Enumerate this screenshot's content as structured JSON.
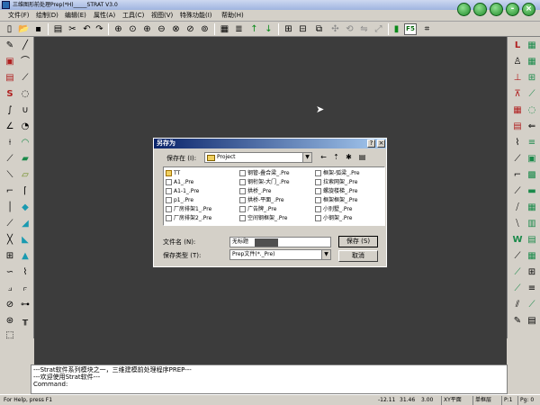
{
  "window": {
    "title": "三维图形前处理Prep(*H)_____STRAT V3.0"
  },
  "menu": [
    "文件(F)",
    "绘制(D)",
    "编辑(E)",
    "属性(A)",
    "工具(C)",
    "视图(V)",
    "特殊功能(I)",
    "帮助(H)"
  ],
  "toolbar": {
    "f5_label": "F5"
  },
  "dialog": {
    "title": "另存为",
    "help_button": "?",
    "close_button": "×",
    "save_in_label": "保存在 (I):",
    "save_in_value": "Project",
    "files": [
      {
        "name": "TT",
        "type": "folder"
      },
      {
        "name": "A1_.Pre",
        "type": "file"
      },
      {
        "name": "A1-1_.Pre",
        "type": "file"
      },
      {
        "name": "p1_.Pre",
        "type": "file"
      },
      {
        "name": "厂房排架1_.Pre",
        "type": "file"
      },
      {
        "name": "厂房排架2_.Pre",
        "type": "file"
      },
      {
        "name": "钢管-叠合梁_.Pre",
        "type": "file"
      },
      {
        "name": "钢桁架-大门_.Pre",
        "type": "file"
      },
      {
        "name": "拱桥_.Pre",
        "type": "file"
      },
      {
        "name": "拱桥-平面_.Pre",
        "type": "file"
      },
      {
        "name": "广告牌_.Pre",
        "type": "file"
      },
      {
        "name": "空间钢框架_.Pre",
        "type": "file"
      },
      {
        "name": "框架-弧梁_.Pre",
        "type": "file"
      },
      {
        "name": "拉索网架_.Pre",
        "type": "file"
      },
      {
        "name": "螺旋楼梯_.Pre",
        "type": "file"
      },
      {
        "name": "框架框架_.Pre",
        "type": "file"
      },
      {
        "name": "小别墅_.Pre",
        "type": "file"
      },
      {
        "name": "小钢架_.Pre",
        "type": "file"
      }
    ],
    "filename_label": "文件名 (N):",
    "filename_value": "无标题",
    "filetype_label": "保存类型 (T):",
    "filetype_value": "Prep文件(*._Pre)",
    "save_button": "保存 (S)",
    "cancel_button": "取消"
  },
  "command_area": {
    "lines": [
      "---Strat软件系列模块之一，三维建模前处理程序PREP---",
      "---欢迎使用Strat软件---",
      "Command:"
    ]
  },
  "status": {
    "help": "For Help, press F1",
    "coord_x": "-12.11",
    "coord_y": "31.46",
    "coord_z": "3.00",
    "plane": "XY平面",
    "structure": "单框层",
    "page_index": "P:1",
    "page_total": "Pg: 0"
  }
}
